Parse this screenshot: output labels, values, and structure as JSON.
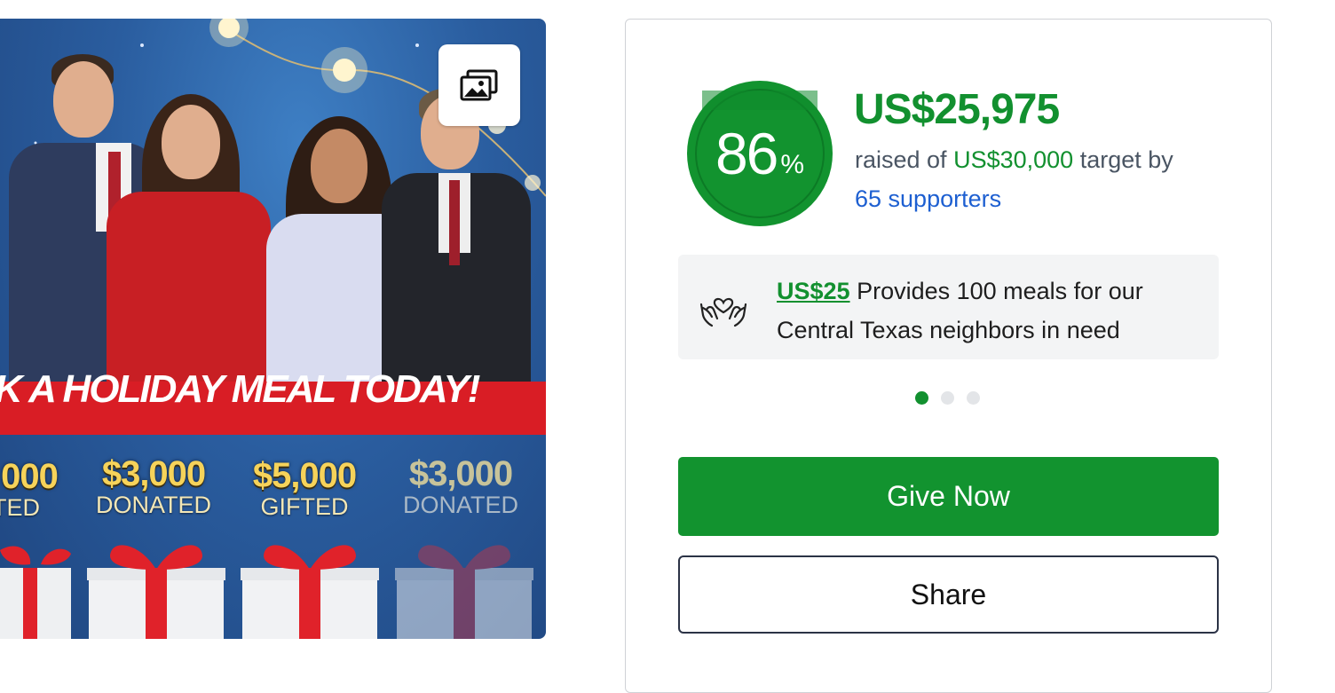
{
  "banner": {
    "headline": "CK A HOLIDAY MEAL TODAY!",
    "stats": [
      {
        "amount": "000",
        "word": "TED",
        "faded": false
      },
      {
        "amount": "$3,000",
        "word": "DONATED",
        "faded": false
      },
      {
        "amount": "$5,000",
        "word": "GIFTED",
        "faded": false
      },
      {
        "amount": "$3,000",
        "word": "DONATED",
        "faded": true
      }
    ],
    "gallery_icon": "gallery-icon"
  },
  "progress": {
    "percent": 86,
    "percent_symbol": "%",
    "raised": "US$25,975",
    "raised_prefix": "raised of",
    "target": "US$30,000",
    "target_suffix": "target by",
    "supporters": "65 supporters"
  },
  "impact": {
    "icon": "heart-hands-icon",
    "amount": "US$25",
    "text": " Provides 100 meals for our Central Texas neighbors in need",
    "slide_count": 3,
    "active_slide": 0
  },
  "actions": {
    "give_label": "Give Now",
    "share_label": "Share"
  },
  "colors": {
    "brand_green": "#12932f",
    "link_blue": "#1d5fd1",
    "banner_red": "#d91d25"
  }
}
